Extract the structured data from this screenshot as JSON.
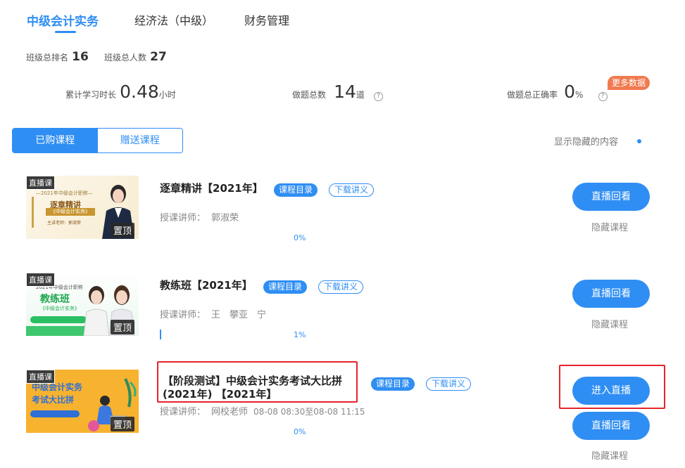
{
  "tabs": [
    "中级会计实务",
    "经济法（中级）",
    "财务管理"
  ],
  "rank": {
    "rank_label": "班级总排名",
    "rank_value": "16",
    "total_label": "班级总人数",
    "total_value": "27"
  },
  "stats": {
    "study_label": "累计学习时长",
    "study_value": "0.48",
    "study_unit": "小时",
    "questions_label": "做题总数",
    "questions_value": "14",
    "questions_unit": "道",
    "accuracy_label": "做题总正确率",
    "accuracy_value": "0",
    "accuracy_unit": "%",
    "help_glyph": "?",
    "more_data": "更多数据"
  },
  "segment": {
    "purchased": "已购课程",
    "gifted": "赠送课程"
  },
  "show_hidden": "显示隐藏的内容",
  "courses": [
    {
      "live_tag": "直播课",
      "pin": "置顶",
      "thumb_line1": "—2021年中级会计职称—",
      "thumb_line2": "逐章精讲",
      "thumb_line3": "《中级会计实务》",
      "thumb_line4": "主讲老师：郭淑荣",
      "title": "逐章精讲【2021年】",
      "catalog": "课程目录",
      "handout": "下载讲义",
      "teacher_label": "授课讲师：",
      "teacher": "郭淑荣",
      "progress": "0%",
      "primary_button": "直播回看",
      "hide": "隐藏课程"
    },
    {
      "live_tag": "直播课",
      "pin": "置顶",
      "thumb_line1": "2021年中级会计职称",
      "thumb_line2": "教练班",
      "thumb_line3": "《中级会计实务》",
      "title": "教练班【2021年】",
      "catalog": "课程目录",
      "handout": "下载讲义",
      "teacher_label": "授课讲师：",
      "teacher": "王　攀亚　宁",
      "progress": "1%",
      "primary_button": "直播回看",
      "hide": "隐藏课程"
    },
    {
      "live_tag": "直播课",
      "pin": "置顶",
      "thumb_line1": "中级会计实务",
      "thumb_line2": "考试大比拼",
      "title_line1": "【阶段测试】中级会计实务考试大比拼",
      "title_line2": "(2021年) 【2021年】",
      "catalog": "课程目录",
      "handout": "下载讲义",
      "teacher_label": "授课讲师：",
      "teacher": "网校老师",
      "time": "08-08 08:30至08-08 11:15",
      "progress": "0%",
      "enter_button": "进入直播",
      "primary_button": "直播回看",
      "hide": "隐藏课程"
    }
  ],
  "colors": {
    "accent": "#2f8ef3",
    "badge": "#f07a4f",
    "highlight": "#e5242b"
  }
}
